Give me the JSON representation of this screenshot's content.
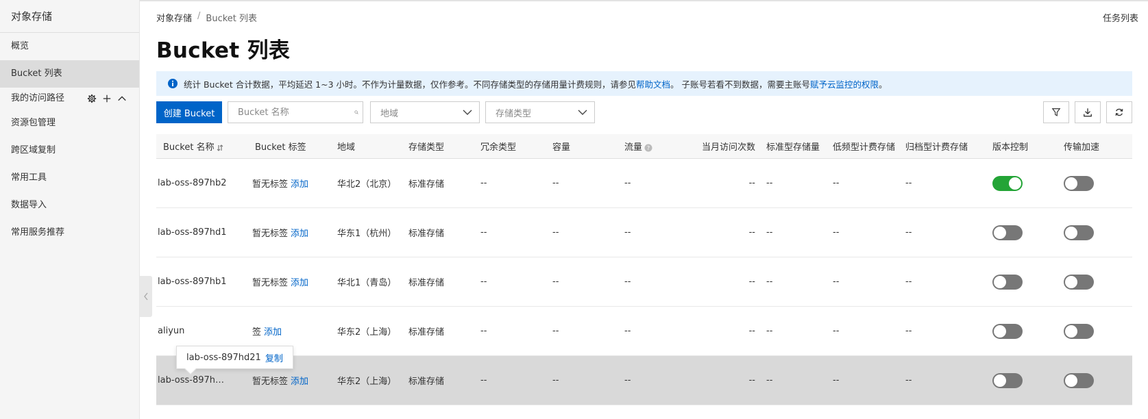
{
  "sidebar": {
    "title": "对象存储",
    "items": [
      {
        "label": "概览"
      },
      {
        "label": "Bucket 列表"
      }
    ],
    "group_label": "我的访问路径",
    "links": [
      {
        "label": "资源包管理"
      },
      {
        "label": "跨区域复制"
      },
      {
        "label": "常用工具"
      },
      {
        "label": "数据导入"
      },
      {
        "label": "常用服务推荐"
      }
    ]
  },
  "breadcrumb": {
    "root": "对象存储",
    "separator": "/",
    "current": "Bucket 列表"
  },
  "header": {
    "task_list": "任务列表",
    "title": "Bucket 列表"
  },
  "notice": {
    "text1": "统计 Bucket 合计数据，平均延迟 1~3 小时。不作为计量数据，仅作参考。不同存储类型的存储用量计费规则，请参见",
    "link1": "帮助文档",
    "text2": "。 子账号若看不到数据，需要主账号",
    "link2": "赋予云监控的权限",
    "text3": "。"
  },
  "toolbar": {
    "create_label": "创建 Bucket",
    "search_placeholder": "Bucket 名称",
    "region_placeholder": "地域",
    "storage_placeholder": "存储类型"
  },
  "table": {
    "headers": {
      "name": "Bucket 名称",
      "tag": "Bucket 标签",
      "region": "地域",
      "storage_type": "存储类型",
      "redundancy": "冗余类型",
      "capacity": "容量",
      "traffic": "流量",
      "visits": "当月访问次数",
      "std_storage": "标准型存储量",
      "low_freq": "低频型计费存储",
      "archive": "归档型计费存储",
      "versioning": "版本控制",
      "acceleration": "传输加速"
    },
    "rows": [
      {
        "name": "lab-oss-897hb2",
        "tag": "暂无标签",
        "tag_add": "添加",
        "region": "华北2（北京）",
        "storage_type": "标准存储",
        "redundancy": "--",
        "capacity": "--",
        "traffic": "--",
        "visits": "--",
        "std_storage": "--",
        "low_freq": "--",
        "archive": "--"
      },
      {
        "name": "lab-oss-897hd1",
        "tag": "暂无标签",
        "tag_add": "添加",
        "region": "华东1（杭州）",
        "storage_type": "标准存储",
        "redundancy": "--",
        "capacity": "--",
        "traffic": "--",
        "visits": "--",
        "std_storage": "--",
        "low_freq": "--",
        "archive": "--"
      },
      {
        "name": "lab-oss-897hb1",
        "tag": "暂无标签",
        "tag_add": "添加",
        "region": "华北1（青岛）",
        "storage_type": "标准存储",
        "redundancy": "--",
        "capacity": "--",
        "traffic": "--",
        "visits": "--",
        "std_storage": "--",
        "low_freq": "--",
        "archive": "--"
      },
      {
        "name": "aliyun",
        "tag": "签",
        "tag_add": "添加",
        "region": "华东2（上海）",
        "storage_type": "标准存储",
        "redundancy": "--",
        "capacity": "--",
        "traffic": "--",
        "visits": "--",
        "std_storage": "--",
        "low_freq": "--",
        "archive": "--"
      },
      {
        "name": "lab-oss-897h…",
        "tag": "暂无标签",
        "tag_add": "添加",
        "region": "华东2（上海）",
        "storage_type": "标准存储",
        "redundancy": "--",
        "capacity": "--",
        "traffic": "--",
        "visits": "--",
        "std_storage": "--",
        "low_freq": "--",
        "archive": "--"
      }
    ],
    "tooltip": {
      "text": "lab-oss-897hd21",
      "copy": "复制"
    }
  },
  "colors": {
    "accent": "#0064c8",
    "toggle_on": "#23a436",
    "toggle_off": "#777777",
    "notice_bg": "#e6f2fd"
  }
}
